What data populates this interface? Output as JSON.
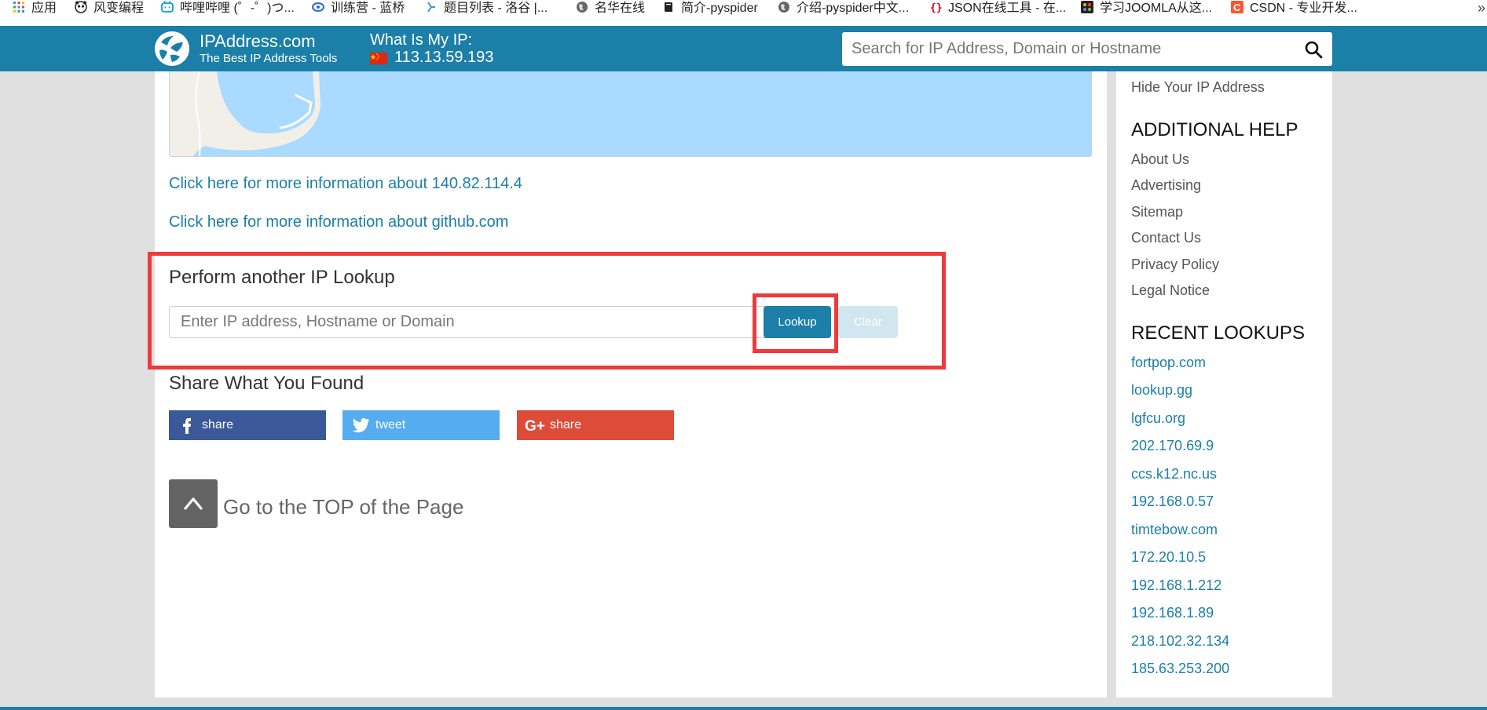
{
  "bookmarks": [
    {
      "label": "应用",
      "icon": "apps-grid-icon",
      "color": "#4285f4"
    },
    {
      "label": "风变编程",
      "icon": "panda-icon",
      "color": "#222222"
    },
    {
      "label": "哔哩哔哩 (゜-゜)つ...",
      "icon": "bilibili-tv-icon",
      "color": "#00a1d6"
    },
    {
      "label": "训练营 - 蓝桥",
      "icon": "lanqiao-icon",
      "color": "#2a6ad6"
    },
    {
      "label": "题目列表 - 洛谷 |...",
      "icon": "luogu-icon",
      "color": "#3498db"
    },
    {
      "label": "名华在线",
      "icon": "globe-icon",
      "color": "#555555"
    },
    {
      "label": "简介-pyspider",
      "icon": "book-icon",
      "color": "#222222"
    },
    {
      "label": "介绍-pyspider中文...",
      "icon": "globe-icon",
      "color": "#555555"
    },
    {
      "label": "JSON在线工具 - 在...",
      "icon": "json-braces-icon",
      "color": "#d0021b"
    },
    {
      "label": "学习JOOMLA从这...",
      "icon": "joomla-icon",
      "color": "#222222"
    },
    {
      "label": "CSDN - 专业开发...",
      "icon": "csdn-icon",
      "color": "#fc5531"
    }
  ],
  "bookmarks_more": "»",
  "header": {
    "brand": "IPAddress.com",
    "tagline": "The Best IP Address Tools",
    "my_ip_label": "What Is My IP:",
    "my_ip_value": "113.13.59.193",
    "flag_icon": "china-flag-icon",
    "search_placeholder": "Search for IP Address, Domain or Hostname",
    "bar_color": "#1b7fa8"
  },
  "main": {
    "link_ip": "Click here for more information about 140.82.114.4",
    "link_domain": "Click here for more information about github.com",
    "lookup_title": "Perform another IP Lookup",
    "lookup_placeholder": "Enter IP address, Hostname or Domain",
    "lookup_button": "Lookup",
    "clear_button": "Clear",
    "share_title": "Share What You Found",
    "share_buttons": [
      {
        "label": "share",
        "icon": "facebook-icon",
        "color": "#3b5998"
      },
      {
        "label": "tweet",
        "icon": "twitter-icon",
        "color": "#55acee"
      },
      {
        "label": "share",
        "icon": "google-plus-icon",
        "color": "#dd4b39"
      }
    ],
    "go_top_glyph": "^",
    "go_top_text": "Go to the TOP of the Page"
  },
  "sidebar": {
    "top_link": "Hide Your IP Address",
    "additional_help_title": "ADDITIONAL HELP",
    "help_links": [
      "About Us",
      "Advertising",
      "Sitemap",
      "Contact Us",
      "Privacy Policy",
      "Legal Notice"
    ],
    "recent_title": "RECENT LOOKUPS",
    "recent_lookups": [
      "fortpop.com",
      "lookup.gg",
      "lgfcu.org",
      "202.170.69.9",
      "ccs.k12.nc.us",
      "192.168.0.57",
      "timtebow.com",
      "172.20.10.5",
      "192.168.1.212",
      "192.168.1.89",
      "218.102.32.134",
      "185.63.253.200"
    ]
  },
  "annotation_color": "#ee3a3a"
}
